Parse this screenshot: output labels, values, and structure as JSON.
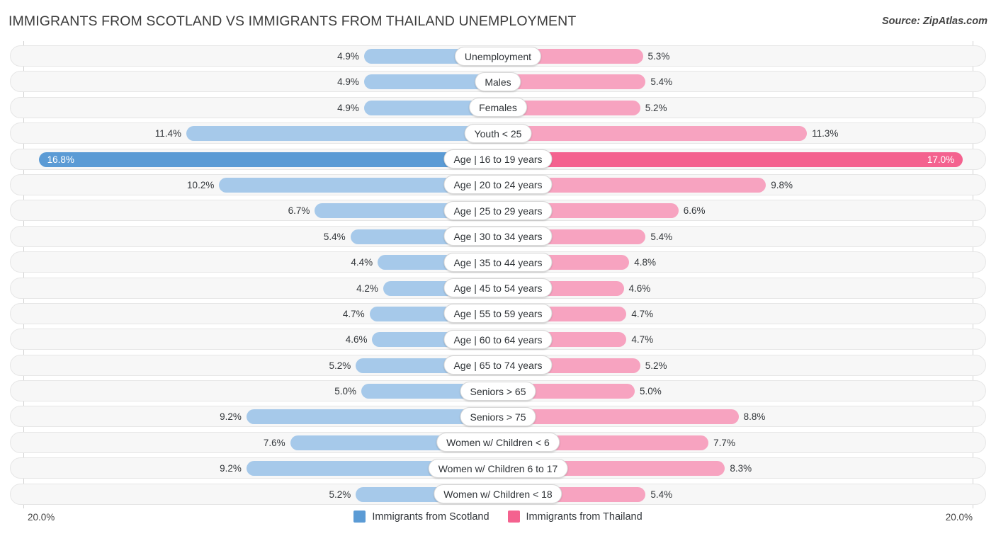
{
  "header": {
    "title": "IMMIGRANTS FROM SCOTLAND VS IMMIGRANTS FROM THAILAND UNEMPLOYMENT",
    "source": "Source: ZipAtlas.com"
  },
  "axis": {
    "left_max_label": "20.0%",
    "right_max_label": "20.0%"
  },
  "legend": {
    "items": [
      {
        "label": "Immigrants from Scotland",
        "color": "#5b9bd5"
      },
      {
        "label": "Immigrants from Thailand",
        "color": "#f4628f"
      }
    ]
  },
  "colors": {
    "left_bar": "#a6c9ea",
    "right_bar": "#f7a3c0",
    "left_bar_highlight": "#5b9bd5",
    "right_bar_highlight": "#f4628f",
    "track": "#f7f7f7"
  },
  "chart_data": {
    "type": "bar",
    "title": "IMMIGRANTS FROM SCOTLAND VS IMMIGRANTS FROM THAILAND UNEMPLOYMENT",
    "subtitle": "",
    "xlabel": "",
    "ylabel": "",
    "orientation": "horizontal-diverging",
    "grid": false,
    "legend_position": "bottom-center",
    "axis_max": 20.0,
    "unit": "%",
    "categories": [
      "Unemployment",
      "Males",
      "Females",
      "Youth < 25",
      "Age | 16 to 19 years",
      "Age | 20 to 24 years",
      "Age | 25 to 29 years",
      "Age | 30 to 34 years",
      "Age | 35 to 44 years",
      "Age | 45 to 54 years",
      "Age | 55 to 59 years",
      "Age | 60 to 64 years",
      "Age | 65 to 74 years",
      "Seniors > 65",
      "Seniors > 75",
      "Women w/ Children < 6",
      "Women w/ Children 6 to 17",
      "Women w/ Children < 18"
    ],
    "series": [
      {
        "name": "Immigrants from Scotland",
        "side": "left",
        "values": [
          4.9,
          4.9,
          4.9,
          11.4,
          16.8,
          10.2,
          6.7,
          5.4,
          4.4,
          4.2,
          4.7,
          4.6,
          5.2,
          5.0,
          9.2,
          7.6,
          9.2,
          5.2
        ],
        "labels": [
          "4.9%",
          "4.9%",
          "4.9%",
          "11.4%",
          "16.8%",
          "10.2%",
          "6.7%",
          "5.4%",
          "4.4%",
          "4.2%",
          "4.7%",
          "4.6%",
          "5.2%",
          "5.0%",
          "9.2%",
          "7.6%",
          "9.2%",
          "5.2%"
        ]
      },
      {
        "name": "Immigrants from Thailand",
        "side": "right",
        "values": [
          5.3,
          5.4,
          5.2,
          11.3,
          17.0,
          9.8,
          6.6,
          5.4,
          4.8,
          4.6,
          4.7,
          4.7,
          5.2,
          5.0,
          8.8,
          7.7,
          8.3,
          5.4
        ],
        "labels": [
          "5.3%",
          "5.4%",
          "5.2%",
          "11.3%",
          "17.0%",
          "9.8%",
          "6.6%",
          "5.4%",
          "4.8%",
          "4.6%",
          "4.7%",
          "4.7%",
          "5.2%",
          "5.0%",
          "8.8%",
          "7.7%",
          "8.3%",
          "5.4%"
        ]
      }
    ],
    "highlighted_category": "Age | 16 to 19 years"
  }
}
